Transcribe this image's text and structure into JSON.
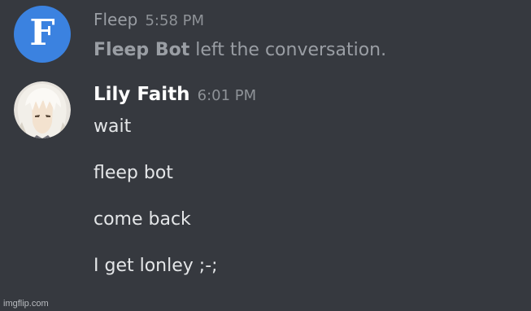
{
  "colors": {
    "background": "#36393f",
    "fleep_avatar": "#3b82e0"
  },
  "system_message": {
    "author": "Fleep",
    "timestamp": "5:58 PM",
    "avatar_letter": "F",
    "actor": "Fleep Bot",
    "action_text": "left the conversation."
  },
  "user_message": {
    "author": "Lily Faith",
    "timestamp": "6:01 PM",
    "avatar_icon": "anime-character-avatar",
    "lines": [
      "wait",
      "fleep bot",
      "come back",
      "I get lonley ;-;"
    ]
  },
  "watermark": "imgflip.com"
}
